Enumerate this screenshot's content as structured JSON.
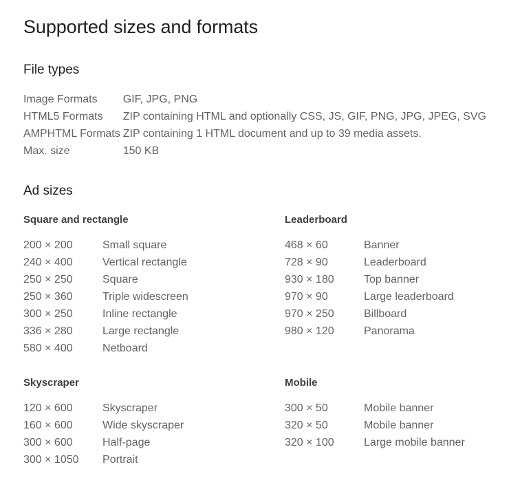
{
  "page": {
    "title": "Supported sizes and formats"
  },
  "file_types": {
    "heading": "File types",
    "rows": [
      {
        "label": "Image Formats",
        "value": "GIF, JPG, PNG"
      },
      {
        "label": "HTML5 Formats",
        "value": "ZIP containing HTML and optionally CSS, JS, GIF, PNG, JPG, JPEG, SVG"
      },
      {
        "label": "AMPHTML Formats",
        "value": "ZIP containing 1 HTML document and up to 39 media assets."
      },
      {
        "label": "Max. size",
        "value": "150 KB"
      }
    ]
  },
  "ad_sizes": {
    "heading": "Ad sizes",
    "groups": [
      {
        "title": "Square and rectangle",
        "items": [
          {
            "dim": "200 × 200",
            "name": "Small square"
          },
          {
            "dim": "240 × 400",
            "name": "Vertical rectangle"
          },
          {
            "dim": "250 × 250",
            "name": "Square"
          },
          {
            "dim": "250 × 360",
            "name": "Triple widescreen"
          },
          {
            "dim": "300 × 250",
            "name": "Inline rectangle"
          },
          {
            "dim": "336 × 280",
            "name": "Large rectangle"
          },
          {
            "dim": "580 × 400",
            "name": "Netboard"
          }
        ]
      },
      {
        "title": "Leaderboard",
        "items": [
          {
            "dim": "468 × 60",
            "name": "Banner"
          },
          {
            "dim": "728 × 90",
            "name": "Leaderboard"
          },
          {
            "dim": "930 × 180",
            "name": "Top banner"
          },
          {
            "dim": "970 × 90",
            "name": "Large leaderboard"
          },
          {
            "dim": "970 × 250",
            "name": "Billboard"
          },
          {
            "dim": "980 × 120",
            "name": "Panorama"
          }
        ]
      },
      {
        "title": "Skyscraper",
        "items": [
          {
            "dim": "120 × 600",
            "name": "Skyscraper"
          },
          {
            "dim": "160 × 600",
            "name": "Wide skyscraper"
          },
          {
            "dim": "300 × 600",
            "name": "Half-page"
          },
          {
            "dim": "300 × 1050",
            "name": "Portrait"
          }
        ]
      },
      {
        "title": "Mobile",
        "items": [
          {
            "dim": "300 × 50",
            "name": "Mobile banner"
          },
          {
            "dim": "320 × 50",
            "name": "Mobile banner"
          },
          {
            "dim": "320 × 100",
            "name": "Large mobile banner"
          }
        ]
      }
    ]
  },
  "colors": {
    "background": "#ffffff",
    "title_text": "#202124",
    "group_title_text": "#3c4043",
    "body_text": "#5f6368"
  }
}
